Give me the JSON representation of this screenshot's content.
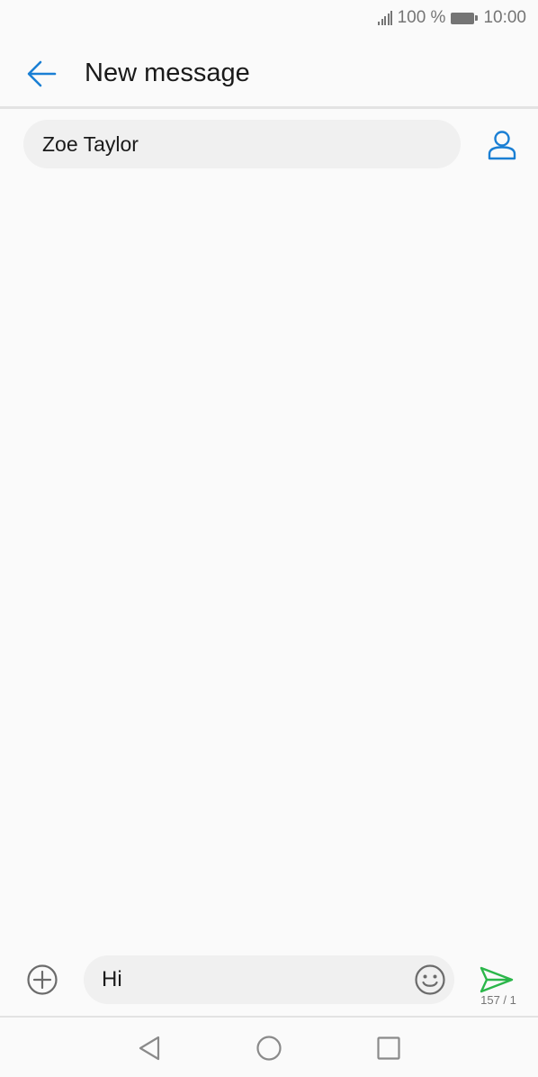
{
  "status_bar": {
    "battery_text": "100 %",
    "time": "10:00",
    "icons": [
      "signal-icon",
      "battery-icon"
    ]
  },
  "header": {
    "title": "New message",
    "back_icon": "back-arrow-icon"
  },
  "recipient": {
    "value": "Zoe Taylor",
    "contact_icon": "contact-person-icon"
  },
  "composer": {
    "message_value": "Hi",
    "char_counter": "157 / 1",
    "attach_icon": "add-circle-icon",
    "emoji_icon": "emoji-icon",
    "send_icon": "send-icon"
  },
  "nav_bar": {
    "icons": [
      "nav-back-icon",
      "nav-home-icon",
      "nav-recents-icon"
    ]
  },
  "colors": {
    "accent": "#1a7fd4",
    "send": "#2bb64a",
    "background": "#fafafa",
    "field": "#f0f0f0"
  }
}
